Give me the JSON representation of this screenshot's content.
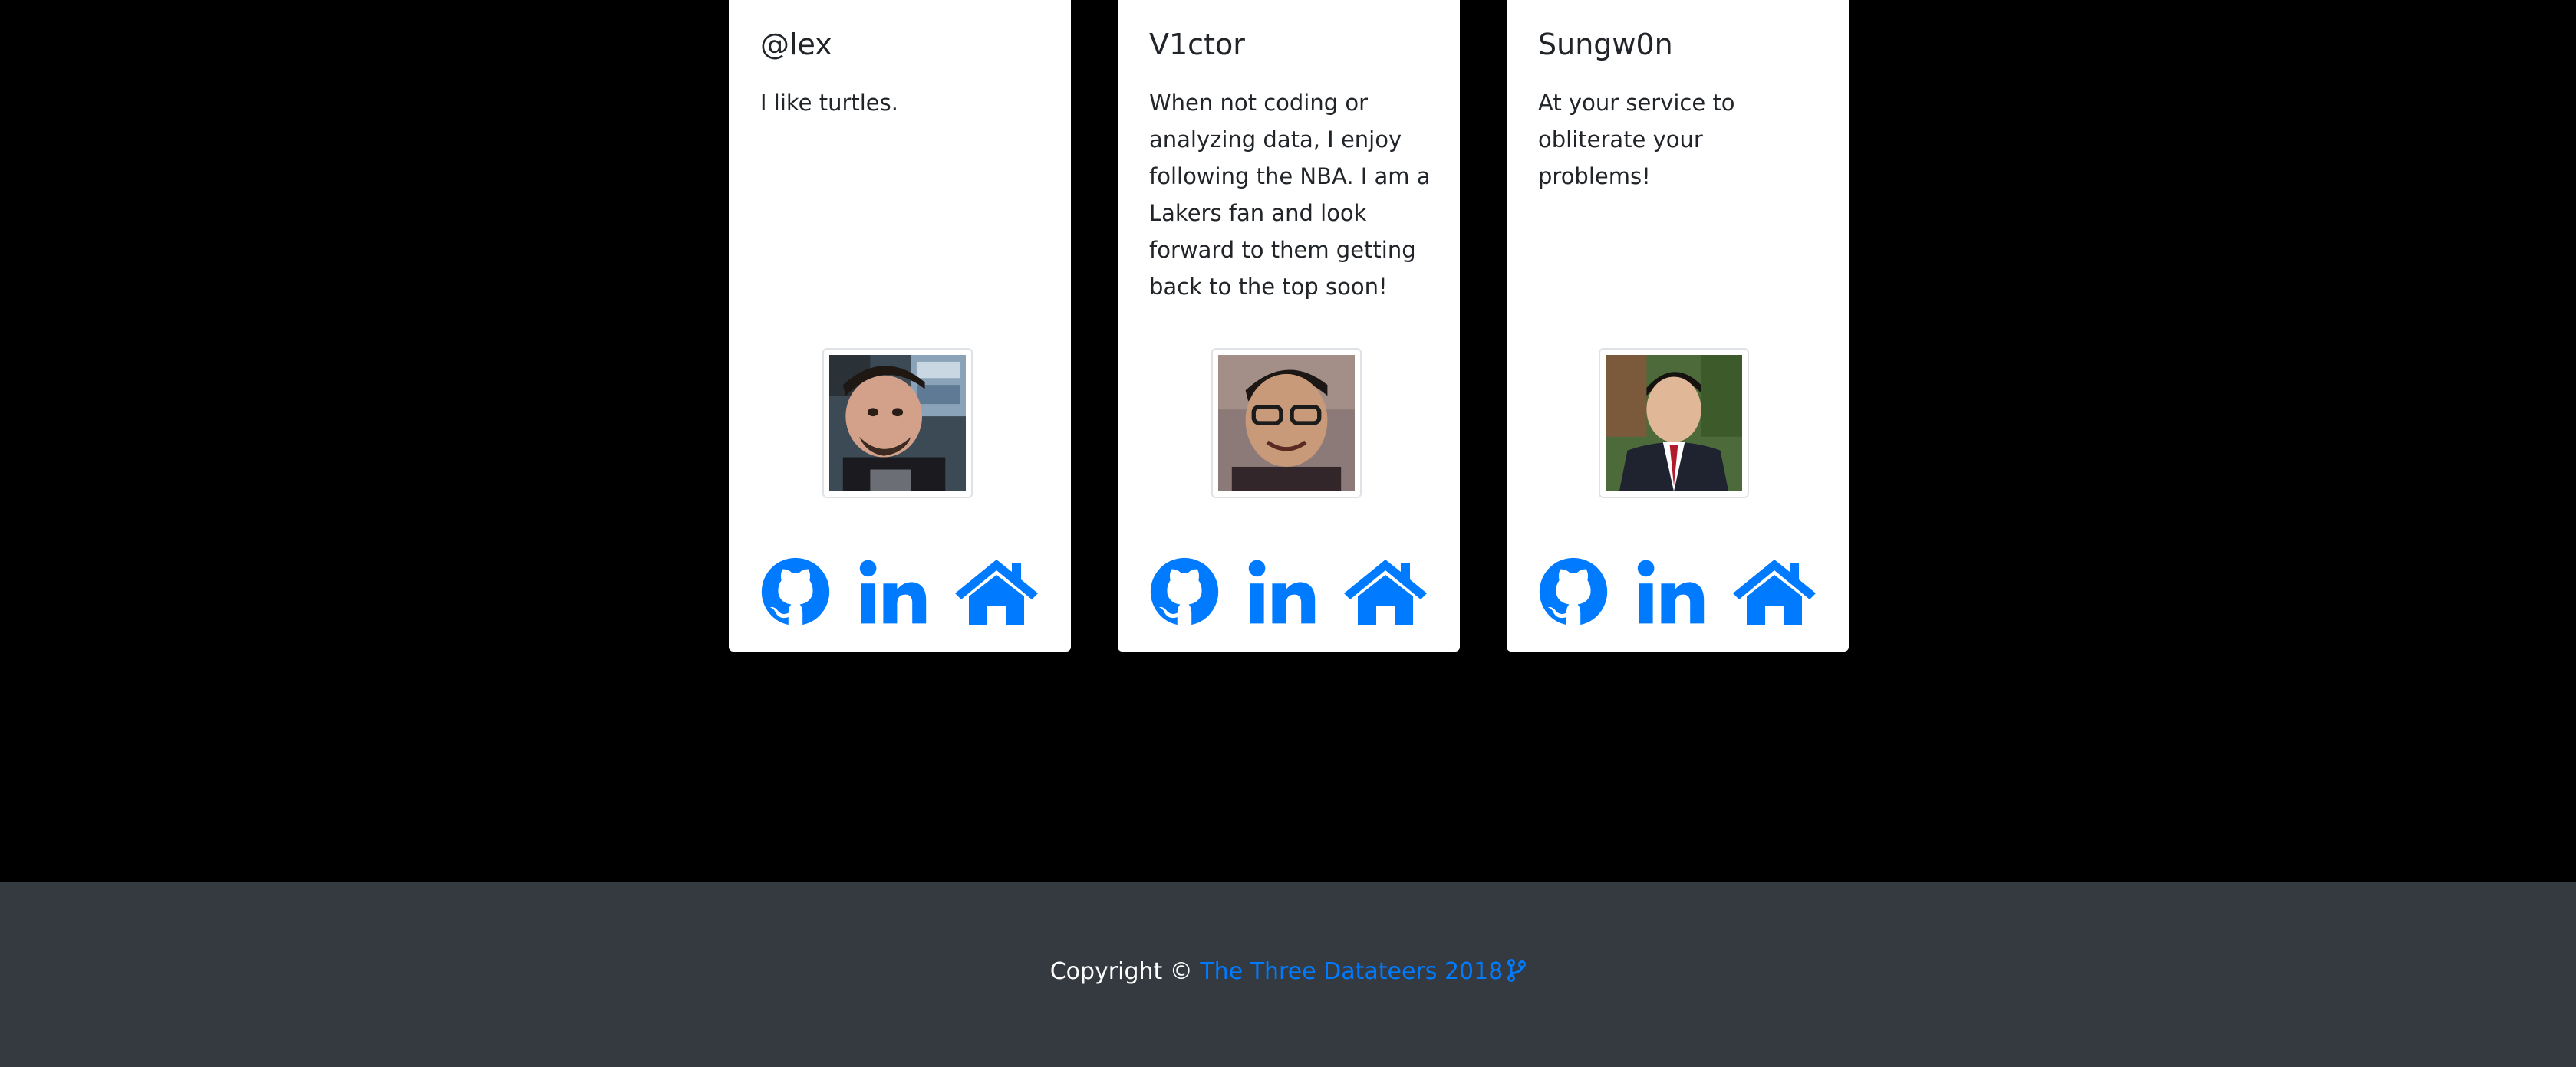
{
  "colors": {
    "page_background": "#000000",
    "card_background": "#ffffff",
    "icon_blue": "#007bff",
    "footer_background": "#343a40",
    "footer_text": "#ffffff"
  },
  "team": [
    {
      "name": "@lex",
      "bio": "I like turtles.",
      "avatar_alt": "photo of @lex",
      "icons": [
        "github-icon",
        "linkedin-icon",
        "home-icon"
      ]
    },
    {
      "name": "V1ctor",
      "bio": "When not coding or analyzing data, I enjoy following the NBA. I am a Lakers fan and look forward to them getting back to the top soon!",
      "avatar_alt": "photo of V1ctor",
      "icons": [
        "github-icon",
        "linkedin-icon",
        "home-icon"
      ]
    },
    {
      "name": "Sungw0n",
      "bio": "At your service to obliterate your problems!",
      "avatar_alt": "photo of Sungw0n",
      "icons": [
        "github-icon",
        "linkedin-icon",
        "home-icon"
      ]
    }
  ],
  "footer": {
    "copyright_label": "Copyright ©",
    "link_text": "The Three Datateers 2018",
    "link_icon": "code-branch-icon"
  }
}
